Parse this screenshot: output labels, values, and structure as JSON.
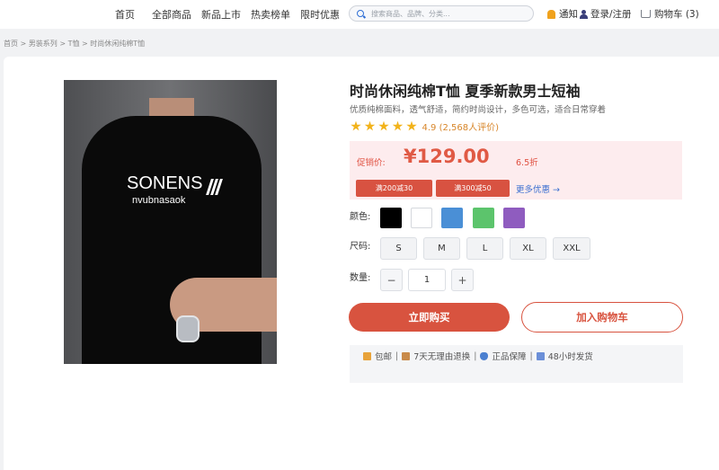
{
  "header": {
    "nav": [
      "首页",
      "全部商品",
      "新品上市",
      "热卖榜单",
      "限时优惠"
    ],
    "search_placeholder": "搜索商品、品牌、分类...",
    "notify": "通知",
    "login": "登录/注册",
    "cart": "购物车 (3)"
  },
  "breadcrumb": "首页 > 男装系列 > T恤 > 时尚休闲纯棉T恤",
  "product": {
    "image_brand": "SONENS",
    "image_sub": "nvubnasaok",
    "title": "时尚休闲纯棉T恤 夏季新款男士短袖",
    "subtitle": "优质纯棉面料，透气舒适，简约时尚设计，多色可选，适合日常穿着",
    "stars": 5,
    "rating": "4.9 (2,568人评价)",
    "promo_label": "促销价:",
    "price": "¥129.00",
    "discount": "6.5折",
    "coupons": [
      "满200减30",
      "满300减50"
    ],
    "more_offers": "更多优惠 →",
    "color_label": "颜色:",
    "colors": [
      "#000000",
      "#ffffff",
      "#4a8fd6",
      "#5cc46c",
      "#8f5cbf"
    ],
    "size_label": "尺码:",
    "sizes": [
      "S",
      "M",
      "L",
      "XL",
      "XXL"
    ],
    "qty_label": "数量:",
    "qty_minus": "−",
    "qty_value": "1",
    "qty_plus": "+",
    "buy_now": "立即购买",
    "add_to_cart": "加入购物车",
    "services": [
      "包邮",
      "7天无理由退换",
      "正品保障",
      "48小时发货"
    ],
    "separator": "|"
  },
  "colors": {
    "accent": "#d8533f",
    "price": "#e05a45",
    "star": "#f2b31b",
    "link": "#3b6fd0"
  }
}
